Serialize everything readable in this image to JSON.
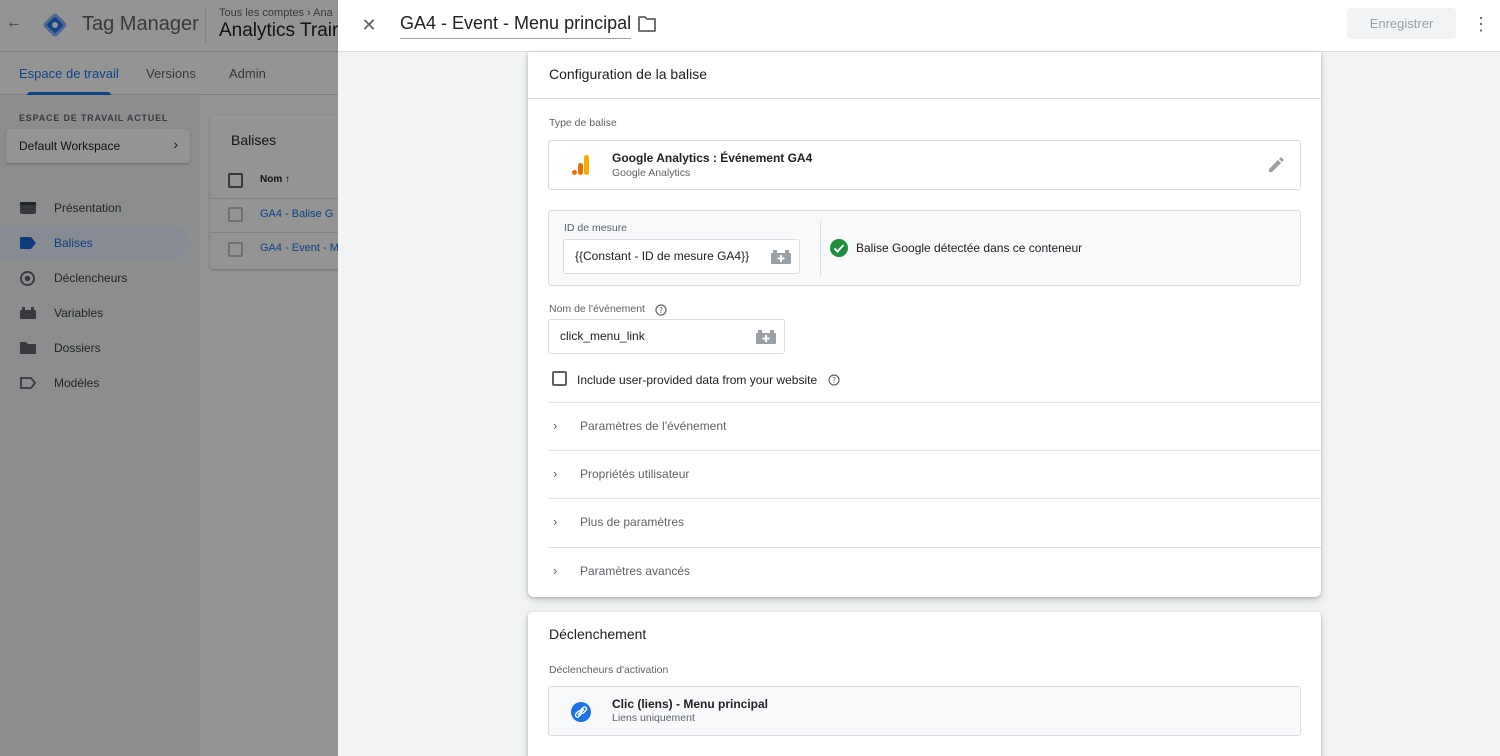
{
  "background": {
    "back_arrow": "←",
    "product_name": "Tag Manager",
    "breadcrumb": "Tous les comptes › Ana",
    "account_name": "Analytics Trair",
    "nav_tabs": [
      {
        "label": "Espace de travail",
        "active": true
      },
      {
        "label": "Versions",
        "active": false
      },
      {
        "label": "Admin",
        "active": false
      }
    ],
    "workspace_section_label": "ESPACE DE TRAVAIL ACTUEL",
    "workspace_name": "Default Workspace",
    "menu": [
      {
        "label": "Présentation",
        "icon": "overview-icon"
      },
      {
        "label": "Balises",
        "icon": "tag-icon",
        "active": true
      },
      {
        "label": "Déclencheurs",
        "icon": "trigger-icon"
      },
      {
        "label": "Variables",
        "icon": "variable-icon"
      },
      {
        "label": "Dossiers",
        "icon": "folder-icon"
      },
      {
        "label": "Modèles",
        "icon": "template-icon"
      }
    ],
    "tags_card": {
      "title": "Balises",
      "column_name": "Nom ↑",
      "rows": [
        "GA4 - Balise G",
        "GA4 - Event - M"
      ]
    }
  },
  "panel": {
    "title": "GA4 - Event - Menu principal",
    "save_label": "Enregistrer",
    "more_glyph": "⋮",
    "close_glyph": "✕",
    "config": {
      "title": "Configuration de la balise",
      "tag_type_label": "Type de balise",
      "tag_type_name": "Google Analytics : Événement GA4",
      "tag_type_sub": "Google Analytics",
      "measure_id_label": "ID de mesure",
      "measure_id_value": "{{Constant - ID de mesure GA4}}",
      "detected_text": "Balise Google détectée dans ce conteneur",
      "event_name_label": "Nom de l'événement",
      "event_name_value": "click_menu_link",
      "include_user_data_label": "Include user-provided data from your website",
      "include_user_data_checked": false,
      "sections": [
        "Paramètres de l'événement",
        "Propriétés utilisateur",
        "Plus de paramètres",
        "Paramètres avancés"
      ]
    },
    "triggering": {
      "title": "Déclenchement",
      "firing_label": "Déclencheurs d'activation",
      "trigger_name": "Clic (liens) - Menu principal",
      "trigger_sub": "Liens uniquement"
    }
  },
  "colors": {
    "accent_blue": "#1a73e8",
    "success_green": "#1e8e3e",
    "ga_orange": "#f9ab00",
    "ga_dark_orange": "#e37400"
  }
}
